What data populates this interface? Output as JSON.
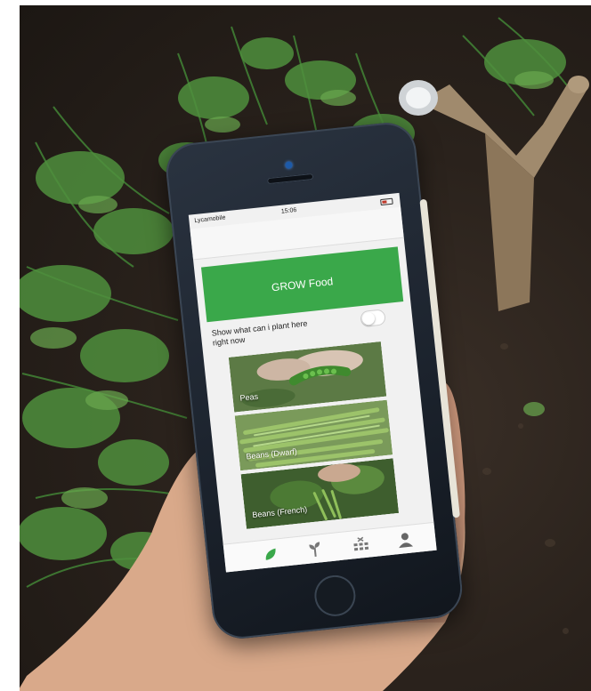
{
  "colors": {
    "header_green": "#3aa84a",
    "soil": "#2a221c",
    "foliage": "#2f6b2a",
    "sensor": "#a08a6d"
  },
  "status_bar": {
    "carrier": "Lycamobile",
    "time": "15:06"
  },
  "app": {
    "header_title": "GROW Food",
    "toggle_label": "Show what can i plant here right now",
    "toggle_on": false
  },
  "crops": [
    {
      "label": "Peas",
      "icon": "peas-photo"
    },
    {
      "label": "Beans (Dwarf)",
      "icon": "beans-photo"
    },
    {
      "label": "Beans (French)",
      "icon": "beans-plant-photo"
    }
  ],
  "tab_bar": {
    "tabs": [
      {
        "icon": "leaf-icon"
      },
      {
        "icon": "seedling-icon"
      },
      {
        "icon": "garden-beds-icon"
      },
      {
        "icon": "user-icon"
      }
    ]
  }
}
